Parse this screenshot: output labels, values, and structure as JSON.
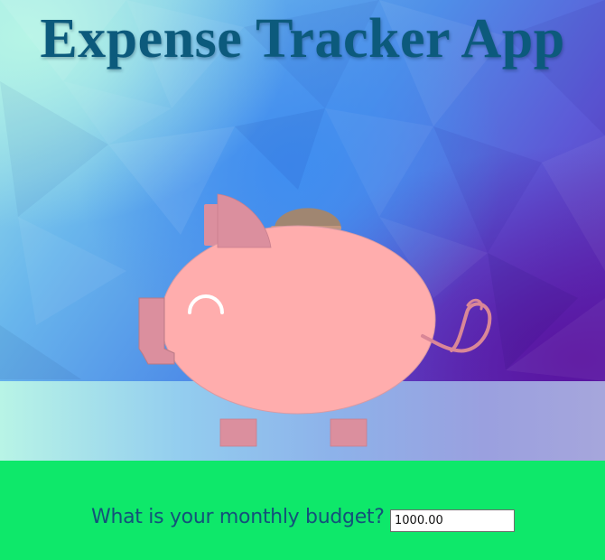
{
  "header": {
    "title": "Expense Tracker App"
  },
  "hero": {
    "illustration_icon": "piggy-bank-icon",
    "coin_icon": "coin-icon"
  },
  "budget": {
    "question": "What is your monthly budget?",
    "value": "1000.00"
  },
  "colors": {
    "title": "#0c5a7c",
    "question_text": "#14517a",
    "footer_background": "#0ee86a",
    "pig_body": "#ffadad",
    "pig_ear": "#db8f9e",
    "coin": "#b0855a"
  }
}
